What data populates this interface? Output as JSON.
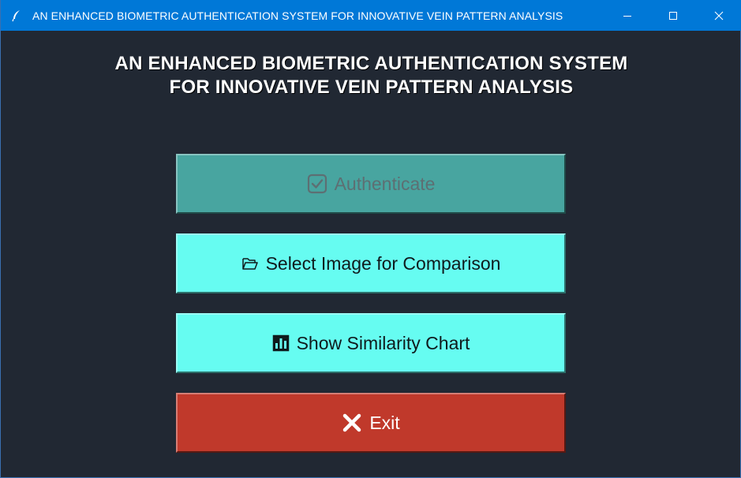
{
  "window": {
    "title": "AN ENHANCED BIOMETRIC AUTHENTICATION SYSTEM FOR INNOVATIVE VEIN PATTERN ANALYSIS",
    "controls": {
      "minimize_icon": "minimize-icon",
      "maximize_icon": "maximize-icon",
      "close_icon": "close-icon"
    }
  },
  "header": {
    "line1": "AN ENHANCED BIOMETRIC AUTHENTICATION SYSTEM",
    "line2": "FOR INNOVATIVE VEIN PATTERN ANALYSIS"
  },
  "buttons": {
    "authenticate": {
      "label": "Authenticate",
      "icon": "checkbox-check-icon",
      "state": "disabled"
    },
    "select_image": {
      "label": "Select Image for Comparison",
      "icon": "open-folder-icon"
    },
    "show_chart": {
      "label": "Show Similarity Chart",
      "icon": "bar-chart-icon"
    },
    "exit": {
      "label": "Exit",
      "icon": "cross-mark-icon"
    }
  },
  "colors": {
    "background": "#212833",
    "titlebar": "#0078d7",
    "authenticate_bg": "#48a5a0",
    "primary_button_bg": "#66fcf1",
    "exit_bg": "#c0392b"
  }
}
